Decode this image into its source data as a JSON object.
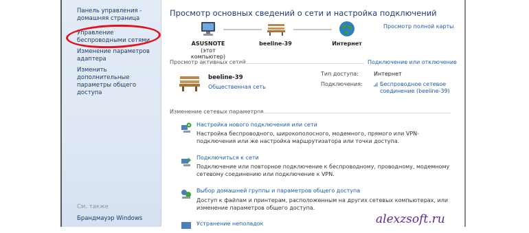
{
  "nav": {
    "home": "Панель управления - домашняя страница",
    "wireless": "Управление беспроводными сетями",
    "adapter": "Изменение параметров адаптера",
    "sharing": "Изменить дополнительные параметры общего доступа",
    "see_also": "См. также",
    "firewall": "Брандмауэр Windows"
  },
  "header": {
    "title": "Просмотр основных сведений о сети и настройка подключений",
    "full_map": "Просмотр полной карты"
  },
  "map": {
    "computer_name": "ASUSNOTE",
    "computer_sub": "(этот компьютер)",
    "network_name": "beeline-39",
    "internet": "Интернет"
  },
  "active": {
    "section_title": "Просмотр активных сетей",
    "connect_link": "Подключение или отключение",
    "network_name": "beeline-39",
    "network_type": "Общественная сеть",
    "access_label": "Тип доступа:",
    "access_value": "Интернет",
    "connections_label": "Подключения:",
    "connections_value": "Беспроводное сетевое соединение (beeline-39)"
  },
  "change": {
    "section_title": "Изменение сетевых параметров",
    "tasks": [
      {
        "title": "Настройка нового подключения или сети",
        "desc": "Настройка беспроводного, широкополосного, модемного, прямого или VPN-подключения или же настройка маршрутизатора или точки доступа."
      },
      {
        "title": "Подключиться к сети",
        "desc": "Подключение или повторное подключение к беспроводному, проводному, модемному сетевому соединению или подключение к VPN."
      },
      {
        "title": "Выбор домашней группы и параметров общего доступа",
        "desc": "Доступ к файлам и принтерам, расположенным на других сетевых компьютерах, или изменение параметров общего доступа."
      },
      {
        "title": "Устранение неполадок"
      }
    ]
  },
  "watermark": "alexzsoft.ru",
  "colors": {
    "link": "#1e5aa8",
    "title": "#1e3d74",
    "highlight_circle": "#e0141b",
    "nav_background": "#e2ebf6",
    "watermark": "#5b2a8c"
  }
}
